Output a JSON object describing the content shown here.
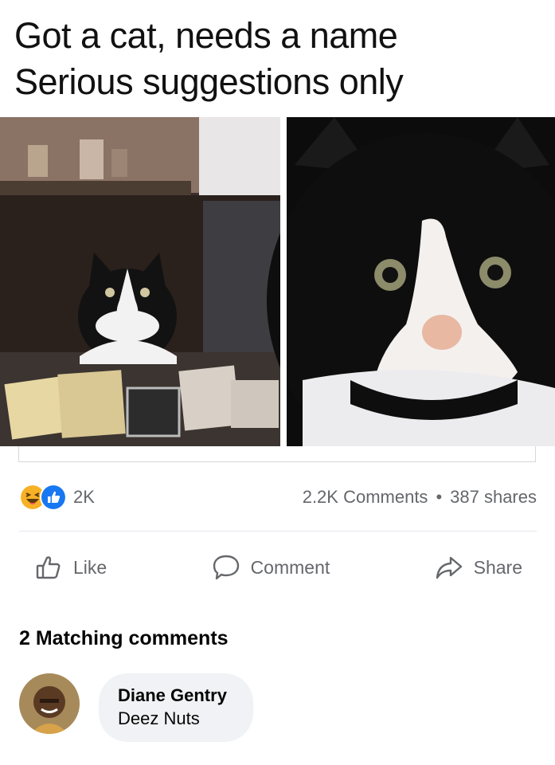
{
  "post": {
    "caption_line1": "Got a cat, needs a name",
    "caption_line2": "Serious suggestions only"
  },
  "photo": {
    "alt": "Two photos of a black and white tuxedo cat"
  },
  "reactions": {
    "icons": [
      "haha-icon",
      "like-icon"
    ],
    "count": "2K",
    "comments": "2.2K Comments",
    "separator": "•",
    "shares": "387 shares"
  },
  "actions": {
    "like_label": "Like",
    "comment_label": "Comment",
    "share_label": "Share"
  },
  "comments_section": {
    "title": "2 Matching comments",
    "items": [
      {
        "author": "Diane Gentry",
        "text": "Deez Nuts"
      }
    ]
  },
  "colors": {
    "secondary_text": "#65676b",
    "like_blue": "#1877f2",
    "haha_yellow": "#f7b125",
    "bubble_bg": "#f0f2f5",
    "divider": "#e4e6eb"
  }
}
